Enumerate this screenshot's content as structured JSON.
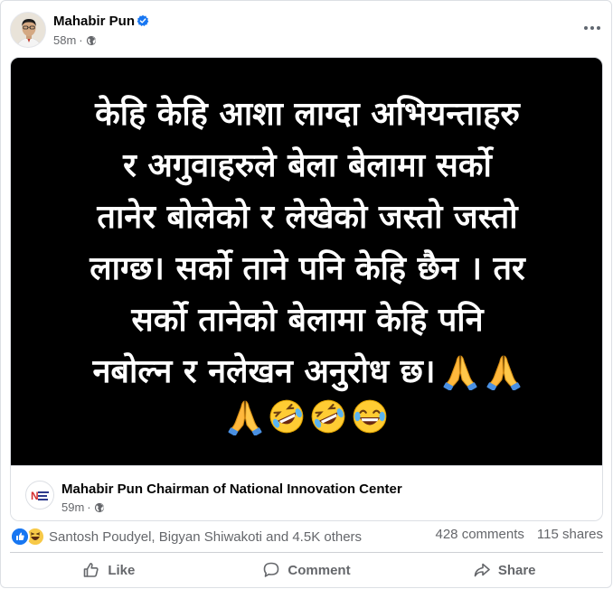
{
  "post": {
    "author": "Mahabir Pun",
    "time": "58m",
    "dot": "·",
    "verified_icon": "verified-badge-icon",
    "privacy_icon": "globe-icon",
    "more_icon": "more-horizontal-icon"
  },
  "image_text": {
    "lines": [
      "केहि केहि आशा लाग्दा अभियन्ताहरु",
      "र अगुवाहरुले बेला बेलामा सर्को",
      "तानेर बोलेको र लेखेको जस्तो जस्तो",
      "लाग्छ। सर्को ताने पनि केहि छैन । तर",
      "सर्को तानेको बेलामा केहि पनि",
      "नबोल्न र नलेखन अनुरोध छ।"
    ],
    "emojis": [
      "folded-hands",
      "folded-hands",
      "folded-hands",
      "rolling-laughing",
      "rolling-laughing",
      "tears-of-joy"
    ]
  },
  "shared_post": {
    "name": "Mahabir Pun Chairman of National Innovation Center",
    "time": "59m",
    "dot": "·",
    "logo_letter": "N"
  },
  "stats": {
    "reaction_icons": [
      "like-icon",
      "haha-icon"
    ],
    "reactors": "Santosh Poudyel, Bigyan Shiwakoti and 4.5K others",
    "comments": "428 comments",
    "shares": "115 shares"
  },
  "actions": {
    "like": "Like",
    "comment": "Comment",
    "share": "Share"
  },
  "colors": {
    "accent": "#1877f2",
    "muted": "#65676b",
    "image_bg": "#000000"
  }
}
